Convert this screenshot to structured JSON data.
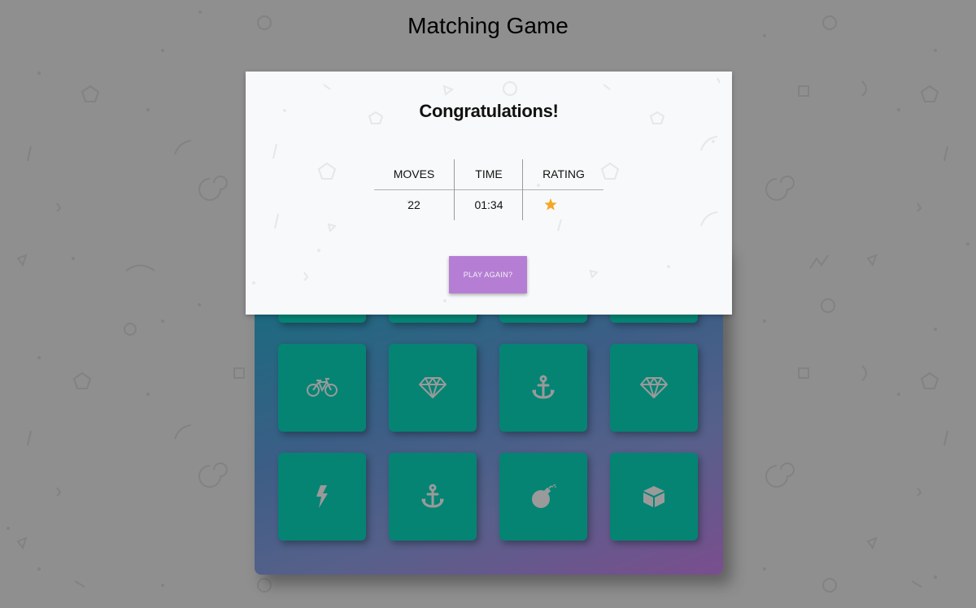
{
  "title": "Matching Game",
  "modal": {
    "heading": "Congratulations!",
    "stats": [
      {
        "label": "MOVES",
        "value": "22"
      },
      {
        "label": "TIME",
        "value": "01:34"
      },
      {
        "label": "RATING",
        "value": ""
      }
    ],
    "rating_stars": 1,
    "play_again_label": "PLAY AGAIN?"
  },
  "cards": {
    "row2": [
      "bicycle-icon",
      "diamond-icon",
      "anchor-icon",
      "diamond-icon"
    ],
    "row3": [
      "bolt-icon",
      "anchor-icon",
      "bomb-icon",
      "cube-icon"
    ]
  },
  "colors": {
    "background": "#8f8f8f",
    "card": "#058474",
    "icon": "#9a9a9a",
    "star": "#f5a623",
    "button": "#b57ed4",
    "modal": "#f8f9fa"
  }
}
